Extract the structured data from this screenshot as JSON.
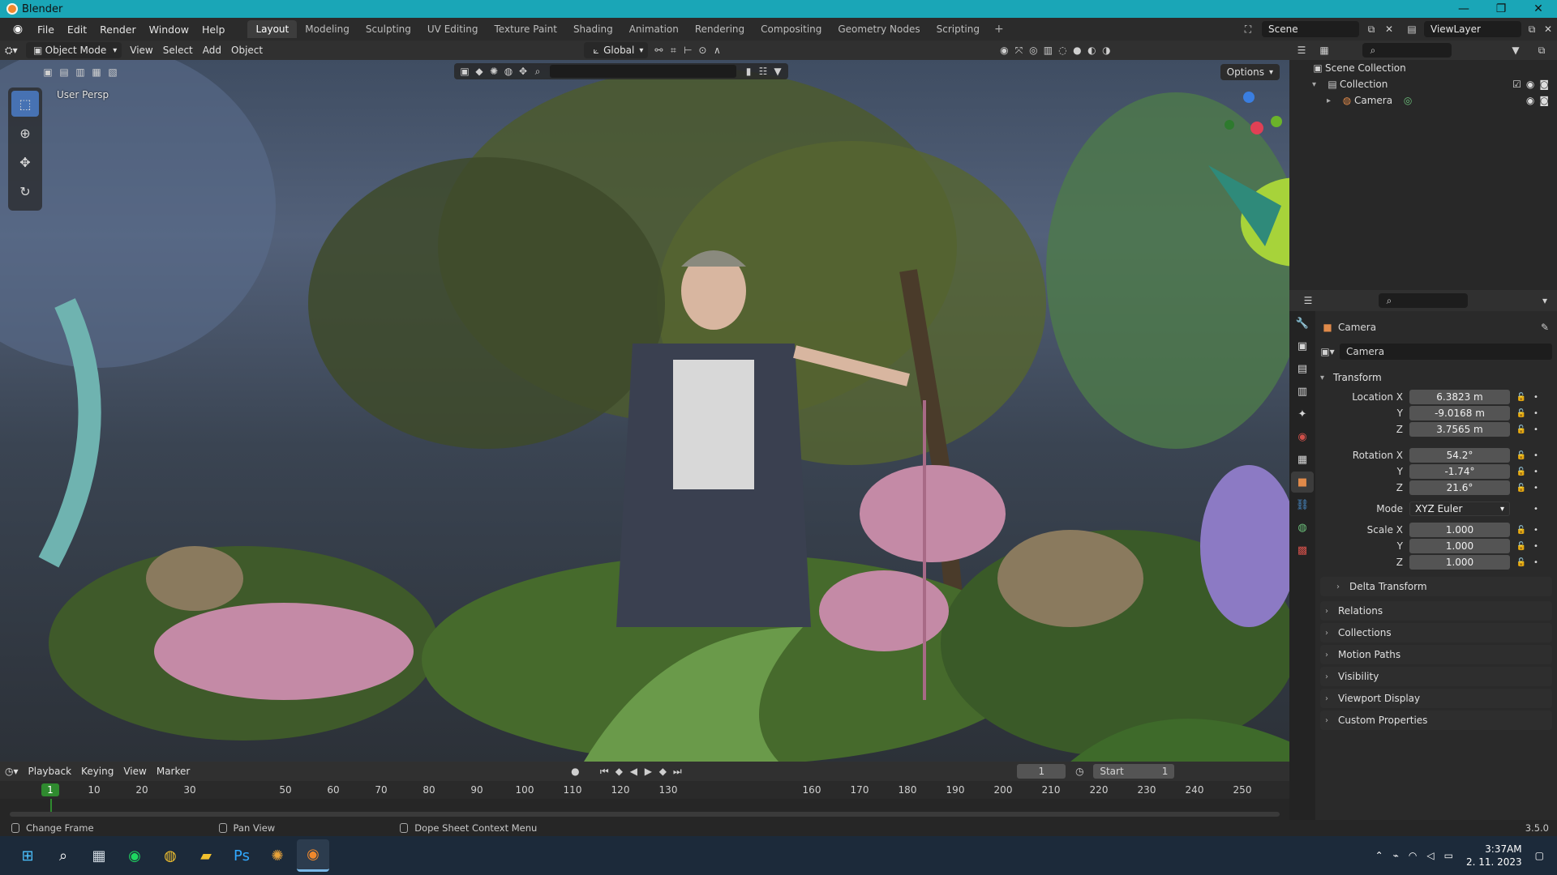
{
  "window": {
    "title": "Blender",
    "minimize": "—",
    "maximize": "❐",
    "close": "✕"
  },
  "menu": [
    "File",
    "Edit",
    "Render",
    "Window",
    "Help"
  ],
  "workspaces": [
    "Layout",
    "Modeling",
    "Sculpting",
    "UV Editing",
    "Texture Paint",
    "Shading",
    "Animation",
    "Rendering",
    "Compositing",
    "Geometry Nodes",
    "Scripting"
  ],
  "workspace_add": "+",
  "scene": {
    "name": "Scene",
    "view_layer": "ViewLayer"
  },
  "viewport_header": {
    "mode": "Object Mode",
    "menus": [
      "View",
      "Select",
      "Add",
      "Object"
    ],
    "orientation": "Global",
    "options": "Options"
  },
  "viewport": {
    "view_label": "User Persp"
  },
  "outliner": {
    "rows": [
      {
        "label": "Scene Collection"
      },
      {
        "label": "Collection"
      },
      {
        "label": "Camera"
      }
    ]
  },
  "properties": {
    "object_name": "Camera",
    "data_name": "Camera",
    "transform_title": "Transform",
    "location": {
      "label": "Location X",
      "x": "6.3823 m",
      "y": "-9.0168 m",
      "z": "3.7565 m"
    },
    "rotation": {
      "label": "Rotation X",
      "x": "54.2°",
      "y": "-1.74°",
      "z": "21.6°"
    },
    "mode": {
      "label": "Mode",
      "value": "XYZ Euler"
    },
    "scale": {
      "label": "Scale X",
      "x": "1.000",
      "y": "1.000",
      "z": "1.000"
    },
    "axis_y": "Y",
    "axis_z": "Z",
    "delta_transform": "Delta Transform",
    "panels": [
      "Relations",
      "Collections",
      "Motion Paths",
      "Visibility",
      "Viewport Display",
      "Custom Properties"
    ]
  },
  "timeline": {
    "menus": [
      "Playback",
      "Keying",
      "View",
      "Marker"
    ],
    "current_frame": "1",
    "start_label": "Start",
    "start_value": "1",
    "ticks": [
      "10",
      "20",
      "30",
      "50",
      "60",
      "70",
      "80",
      "90",
      "100",
      "110",
      "120",
      "130",
      "160",
      "170",
      "180",
      "190",
      "200",
      "210",
      "220",
      "230",
      "240",
      "250"
    ]
  },
  "statusbar": {
    "left": "Change Frame",
    "middle": "Pan View",
    "right": "Dope Sheet Context Menu",
    "version": "3.5.0"
  },
  "taskbar": {
    "time": "3:37AM",
    "date": "2. 11. 2023"
  },
  "colors": {
    "titlebar": "#1aa6b7",
    "active_tool": "#4772b3",
    "current_frame": "#2f8a2f",
    "taskbar": "#1c2a3a"
  }
}
